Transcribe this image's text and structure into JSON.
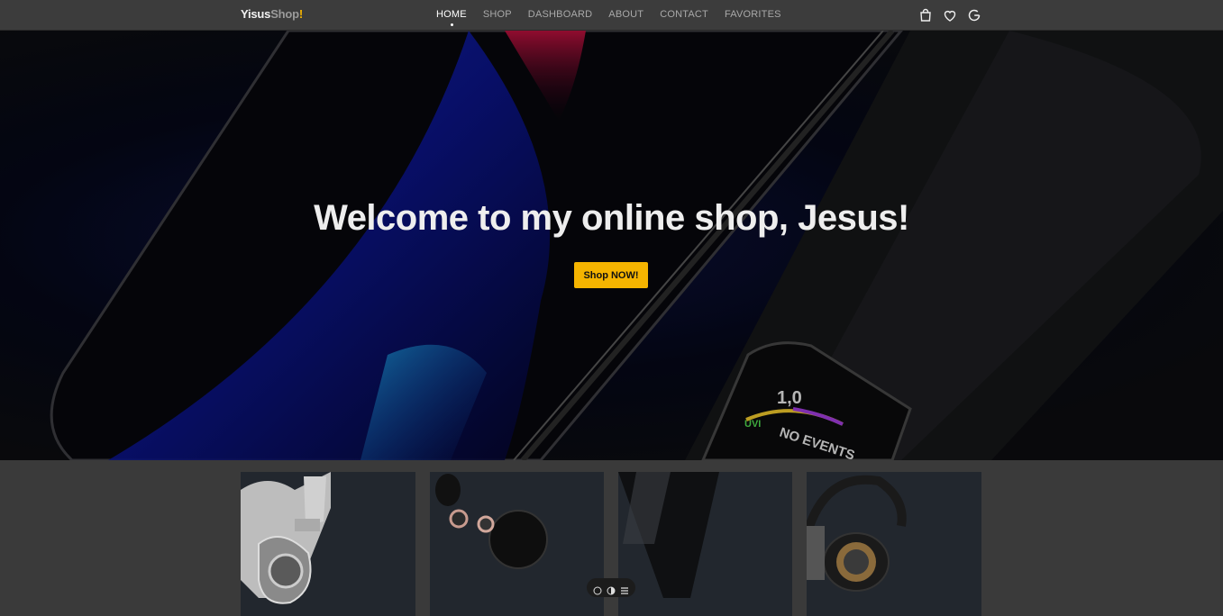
{
  "brand": {
    "part1": "Yisus",
    "part2": "Shop",
    "part3": "!"
  },
  "nav": {
    "items": [
      {
        "label": "HOME",
        "active": true
      },
      {
        "label": "SHOP",
        "active": false
      },
      {
        "label": "DASHBOARD",
        "active": false
      },
      {
        "label": "ABOUT",
        "active": false
      },
      {
        "label": "CONTACT",
        "active": false
      },
      {
        "label": "FAVORITES",
        "active": false
      }
    ]
  },
  "header_icons": [
    "shopping-bag-icon",
    "heart-icon",
    "google-icon"
  ],
  "hero": {
    "title": "Welcome to my online shop, Jesus!",
    "cta_label": "Shop NOW!",
    "watch_text": {
      "value": "1,0",
      "uvi": "UVI",
      "events": "NO EVENTS"
    }
  },
  "products": [
    {
      "image": "over-ear-headphones-silver"
    },
    {
      "image": "wireless-earbuds-black"
    },
    {
      "image": "black-tablet-device"
    },
    {
      "image": "over-ear-headphones-gold"
    }
  ],
  "toolbar_icons": [
    "comment-icon",
    "contrast-icon",
    "menu-icon"
  ],
  "colors": {
    "accent": "#f5b400",
    "navbar": "#3c3c3c",
    "card": "#22272e",
    "page": "#3a3a3a"
  }
}
